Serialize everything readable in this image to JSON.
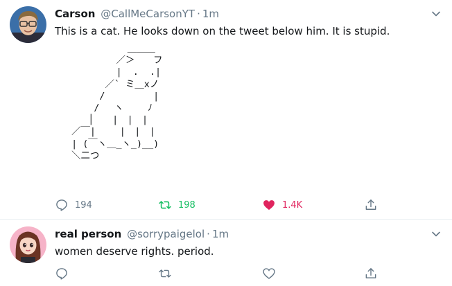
{
  "colors": {
    "text": "#14171a",
    "secondary": "#657786",
    "retweet_green": "#17bf63",
    "like_red": "#e0245e",
    "divider": "#e6ecf0"
  },
  "tweets": [
    {
      "display_name": "Carson",
      "handle": "@CallMeCarsonYT",
      "separator": "·",
      "time": "1m",
      "text": "This is a cat. He looks down on the tweet below him. It is stupid.",
      "ascii_art": "            ＿＿＿\n          ／＞　　フ\n          |  .  .|\n        ／` ミ＿xノ\n       /　　　 　 |\n      /　 ヽ　　 ﾉ\n     │　　|　|　|\n  ／￣|　　 |　|　|\n  | (￣ヽ＿_ヽ_)__)\n  ＼二つ",
      "actions": {
        "reply_count": "194",
        "retweet_count": "198",
        "like_count": "1.4K",
        "retweeted": true,
        "liked": true
      }
    },
    {
      "display_name": "real person",
      "handle": "@sorrypaigelol",
      "separator": "·",
      "time": "1m",
      "text": "women deserve rights. period.",
      "actions": {
        "reply_count": "",
        "retweet_count": "",
        "like_count": "",
        "retweeted": false,
        "liked": false
      }
    }
  ],
  "icons": {
    "caret": "chevron-down-icon",
    "reply": "reply-icon",
    "retweet": "retweet-icon",
    "like": "heart-icon",
    "share": "share-icon"
  }
}
